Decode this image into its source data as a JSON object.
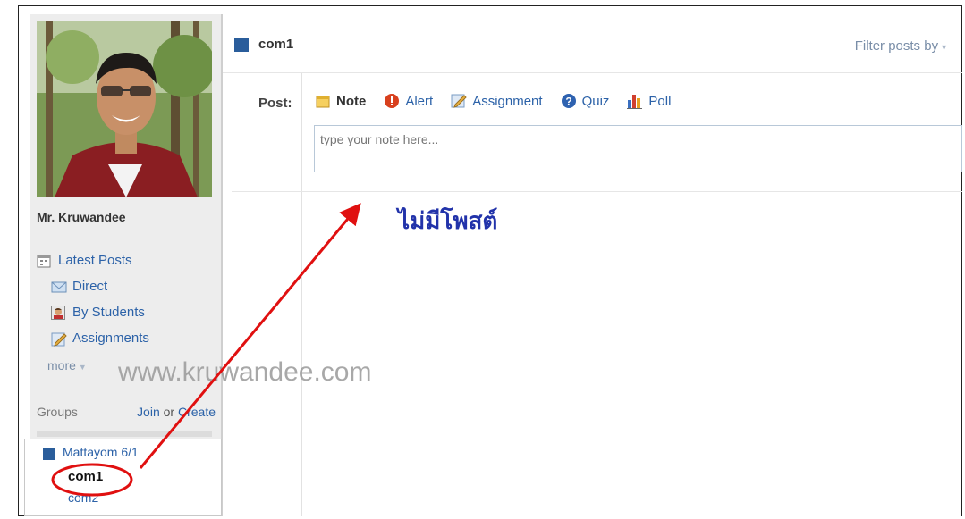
{
  "profile": {
    "name": "Mr. Kruwandee"
  },
  "nav": {
    "items": [
      {
        "label": "Latest Posts",
        "icon": "calendar-icon"
      },
      {
        "label": "Direct",
        "icon": "envelope-icon"
      },
      {
        "label": "By Students",
        "icon": "student-icon"
      },
      {
        "label": "Assignments",
        "icon": "assignment-icon"
      }
    ],
    "more_label": "more"
  },
  "groups": {
    "title": "Groups",
    "join_label": "Join",
    "or_label": "or",
    "create_label": "Create",
    "group_name": "Mattayom 6/1",
    "subgroups": [
      "com1",
      "com2"
    ]
  },
  "main": {
    "title": "com1",
    "filter_label": "Filter posts by",
    "post_label": "Post:",
    "post_types": [
      {
        "label": "Note",
        "icon": "note-icon",
        "active": true
      },
      {
        "label": "Alert",
        "icon": "alert-icon",
        "active": false
      },
      {
        "label": "Assignment",
        "icon": "assignment-icon",
        "active": false
      },
      {
        "label": "Quiz",
        "icon": "quiz-icon",
        "active": false
      },
      {
        "label": "Poll",
        "icon": "poll-icon",
        "active": false
      }
    ],
    "note_placeholder": "type your note here...",
    "empty_text": "ไม่มีโพสต์"
  },
  "watermark": "www.kruwandee.com",
  "colors": {
    "group_square": "#2a5d9b",
    "link": "#2c62a8",
    "annotation": "#e01010",
    "empty_text": "#2233aa"
  }
}
